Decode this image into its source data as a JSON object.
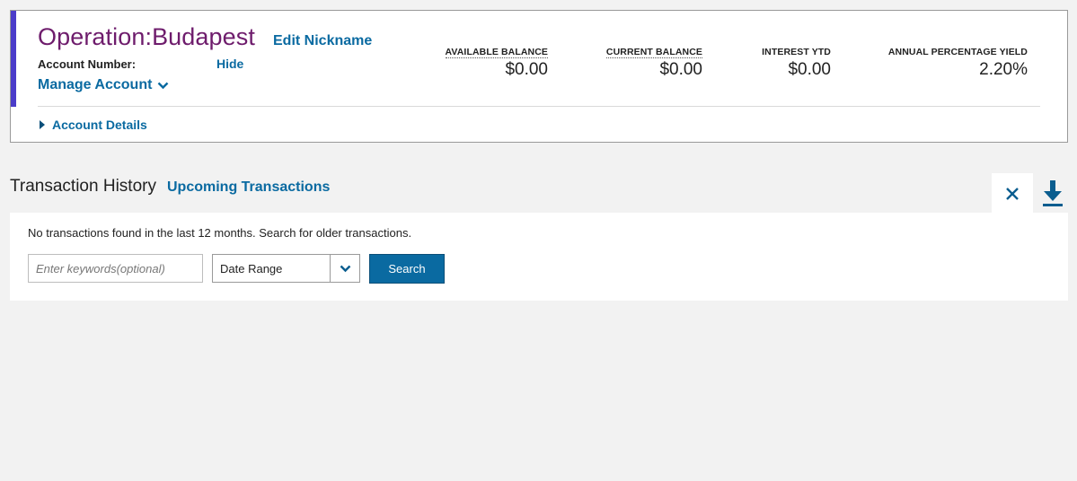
{
  "account": {
    "name": "Operation:Budapest",
    "edit_nickname": "Edit Nickname",
    "account_number_label": "Account Number:",
    "hide_label": "Hide",
    "manage_account": "Manage Account",
    "account_details": "Account Details",
    "accent_color": "#4b3cc9",
    "name_color": "#6e1c6c"
  },
  "stats": {
    "available_balance": {
      "label": "AVAILABLE BALANCE",
      "value": "$0.00"
    },
    "current_balance": {
      "label": "CURRENT BALANCE",
      "value": "$0.00"
    },
    "interest_ytd": {
      "label": "INTEREST YTD",
      "value": "$0.00"
    },
    "apy": {
      "label": "ANNUAL PERCENTAGE YIELD",
      "value": "2.20%"
    }
  },
  "transactions": {
    "title": "Transaction History",
    "upcoming_link": "Upcoming Transactions",
    "empty_message": "No transactions found in the last 12 months. Search for older transactions.",
    "keyword_placeholder": "Enter keywords(optional)",
    "date_range_selected": "Date Range",
    "search_label": "Search",
    "icons": {
      "close": "close-icon",
      "download": "download-icon"
    }
  },
  "theme": {
    "link_color": "#0a6aa1",
    "button_color": "#0a6aa1",
    "background": "#f2f2f2"
  }
}
